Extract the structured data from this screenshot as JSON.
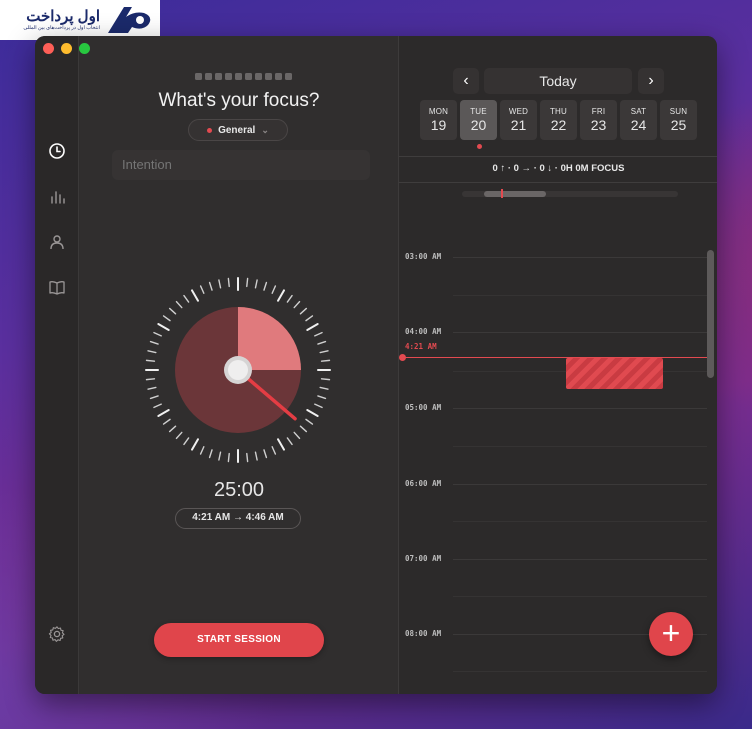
{
  "brand": {
    "title": "اول پرداخت",
    "subtitle": "انتخاب اول در پرداخت‌های بین المللی"
  },
  "colors": {
    "accent": "#e0454b",
    "window_bg": "#2f2d2d"
  },
  "focus": {
    "title": "What's your focus?",
    "tag_label": "General",
    "intention_placeholder": "Intention"
  },
  "timer": {
    "time": "25:00",
    "range": "4:21 AM → 4:46 AM",
    "start_label": "START SESSION",
    "progress_fraction": 0.25
  },
  "calendar": {
    "today_label": "Today",
    "prev_icon": "chevron-left-icon",
    "next_icon": "chevron-right-icon",
    "days": [
      {
        "name": "MON",
        "date": "19"
      },
      {
        "name": "TUE",
        "date": "20"
      },
      {
        "name": "WED",
        "date": "21"
      },
      {
        "name": "THU",
        "date": "22"
      },
      {
        "name": "FRI",
        "date": "23"
      },
      {
        "name": "SAT",
        "date": "24"
      },
      {
        "name": "SUN",
        "date": "25"
      }
    ],
    "selected_day": "TUE",
    "stats": "0 ↑ · 0 → · 0 ↓ · 0H 0M FOCUS",
    "hours": [
      "03:00 AM",
      "04:00 AM",
      "05:00 AM",
      "06:00 AM",
      "07:00 AM",
      "08:00 AM"
    ],
    "now_label": "4:21 AM"
  },
  "sidebar": {
    "items": [
      "clock-icon",
      "chart-icon",
      "person-icon",
      "book-icon"
    ],
    "settings": "gear-icon"
  }
}
